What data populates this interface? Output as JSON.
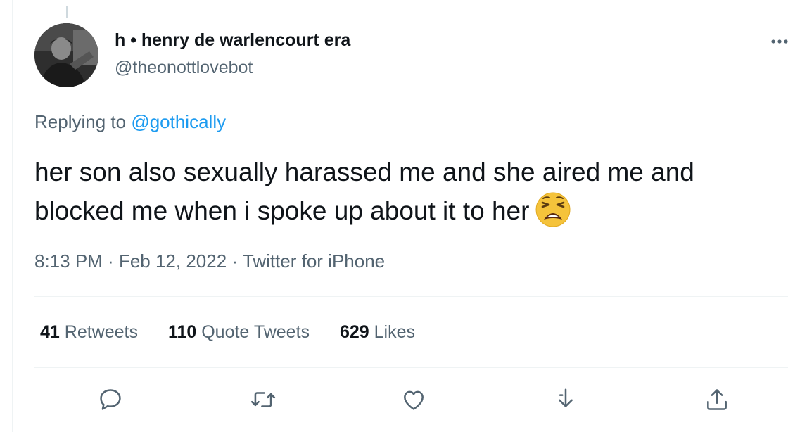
{
  "tweet": {
    "display_name": "h • henry de warlencourt era",
    "handle": "@theonottlovebot",
    "replying_prefix": "Replying to",
    "replying_to": "@gothically",
    "text": "her son also sexually harassed me and she aired me and blocked me when i spoke up about it to her",
    "emoji": "weary-face-emoji",
    "time": "8:13 PM",
    "date": "Feb 12, 2022",
    "client": "Twitter for iPhone",
    "meta_separator": " · "
  },
  "stats": {
    "retweets_count": "41",
    "retweets_label": "Retweets",
    "quotes_count": "110",
    "quotes_label": "Quote Tweets",
    "likes_count": "629",
    "likes_label": "Likes"
  },
  "actions": {
    "reply": "reply-icon",
    "retweet": "retweet-icon",
    "like": "heart-icon",
    "bookmark": "bookmark-download-icon",
    "share": "share-icon"
  },
  "colors": {
    "text": "#0f1419",
    "secondary": "#536471",
    "link": "#1d9bf0",
    "divider": "#eff3f4"
  }
}
